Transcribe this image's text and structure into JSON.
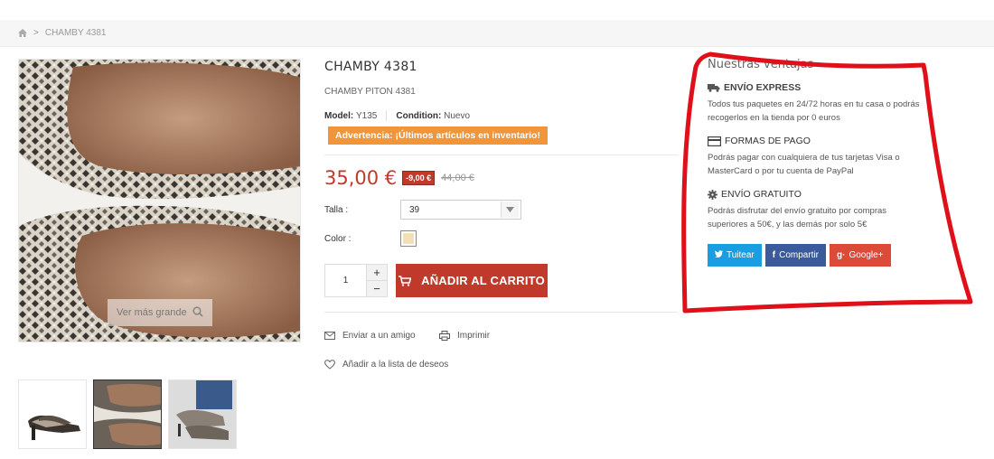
{
  "breadcrumb": {
    "home_icon": "home-icon",
    "separator": ">",
    "current": "CHAMBY 4381"
  },
  "gallery": {
    "zoom_label": "Ver más grande",
    "thumbnails": [
      "side-view",
      "top-view",
      "worn-view"
    ],
    "active_thumbnail_index": 1
  },
  "product": {
    "title": "CHAMBY 4381",
    "subtitle": "CHAMBY PITON 4381",
    "model_label": "Model:",
    "model_value": "Y135",
    "condition_label": "Condition:",
    "condition_value": "Nuevo",
    "warning": "Advertencia: ¡Últimos artículos en inventario!",
    "price": "35,00 €",
    "discount": "-9,00 €",
    "old_price": "44,00 €",
    "size_label": "Talla :",
    "size_value": "39",
    "color_label": "Color :",
    "color_swatch": "#f5dfb7",
    "quantity": "1",
    "qty_plus": "+",
    "qty_minus": "−",
    "add_to_cart": "AÑADIR AL CARRITO",
    "send_friend": "Enviar a un amigo",
    "print": "Imprimir",
    "wishlist": "Añadir a la lista de deseos"
  },
  "advantages": {
    "title": "Nuestras ventajas",
    "items": [
      {
        "heading": "ENVÍO EXPRESS",
        "text": "Todos tus paquetes en 24/72 horas en tu casa o podrás recogerlos en la tienda por 0 euros",
        "icon": "truck-icon"
      },
      {
        "heading": "FORMAS DE PAGO",
        "text": "Podrás pagar con cualquiera de tus tarjetas Visa o MasterCard o por tu cuenta de PayPal",
        "icon": "credit-card-icon"
      },
      {
        "heading": "ENVÍO GRATUITO",
        "text": "Podrás disfrutar del envío gratuito por compras superiores a 50€, y las demás por solo 5€",
        "icon": "gear-icon"
      }
    ],
    "social": {
      "tweet": "Tuitear",
      "share": "Compartir",
      "google": "Google+"
    }
  },
  "colors": {
    "accent": "#c0392b",
    "warning": "#f0953a",
    "annotation": "#e0101a"
  }
}
